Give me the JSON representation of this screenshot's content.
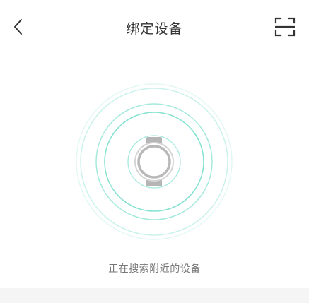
{
  "header": {
    "title": "绑定设备",
    "back_icon": "chevron-left-icon",
    "scan_icon": "scan-frame-icon"
  },
  "main": {
    "status_text": "正在搜索附近的设备",
    "device_icon": "smartwatch-icon"
  },
  "colors": {
    "accent": "#7fe0cf",
    "title": "#333333",
    "status": "#777777",
    "watch": "#b5b5b5",
    "bottom_band": "#f5f5f5"
  }
}
